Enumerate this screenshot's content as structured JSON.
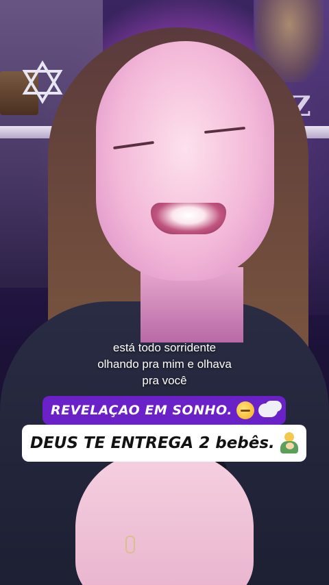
{
  "subtitle": {
    "lines": [
      "está todo sorridente",
      "olhando pra mim e olhava",
      "pra você"
    ]
  },
  "banners": {
    "top": {
      "text": "REVELAÇAO EM SONHO.",
      "emojis": [
        "sleeping-face-icon",
        "thought-cloud-icon"
      ]
    },
    "bottom": {
      "text": "DEUS TE ENTREGA 2 bebês.",
      "emojis": [
        "person-feeding-baby-icon"
      ]
    }
  },
  "colors": {
    "banner_top_bg": "#6a21c8",
    "banner_bottom_bg": "#ffffff",
    "ambient_light": "#d77fc9"
  }
}
